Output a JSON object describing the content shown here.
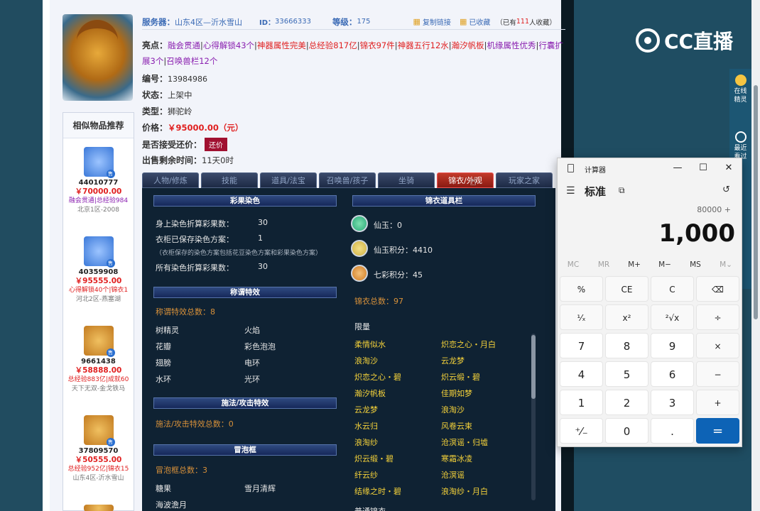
{
  "listing": {
    "server_label": "服务器：",
    "server": "山东4区—沂水雪山",
    "id_label": "ID：",
    "id": "33666333",
    "level_label": "等级：",
    "level": "175",
    "copy_link": "复制链接",
    "favorited": "已收藏",
    "fav_count_pre": "（已有",
    "fav_count": "111",
    "fav_count_post": "人收藏）",
    "highlights_label": "亮点：",
    "highlights": [
      "融会贯通",
      "心得解锁43个",
      "神器属性完美",
      "总经验817亿",
      "锦衣97件",
      "神器五行12水",
      "瀚汐帆板",
      "机缘属性优秀",
      "行囊扩展3个",
      "召唤兽栏12个"
    ],
    "number_label": "编号：",
    "number": "13984986",
    "status_label": "状态：",
    "status": "上架中",
    "type_label": "类型：",
    "type": "狮驼岭",
    "price_label": "价格：",
    "price": "￥95000.00（元）",
    "bargain_label": "是否接受还价：",
    "bargain_button": "还价",
    "remaining_label": "出售剩余时间：",
    "remaining": "11天0时"
  },
  "similar": {
    "title": "相似物品推荐",
    "items": [
      {
        "id": "44010777",
        "price": "￥70000.00",
        "tags": "融会贯通|总经验984",
        "server": "北京1区-2008",
        "color": "#3a78d8"
      },
      {
        "id": "40359908",
        "price": "￥95555.00",
        "tags": "心得解锁40个|锦衣1",
        "server": "河北2区-燕塞湖",
        "color": "#3a78d8"
      },
      {
        "id": "9661438",
        "price": "￥58888.00",
        "tags": "总经验883亿|成就60",
        "server": "天下无双-金戈铁马",
        "color": "#c27a20"
      },
      {
        "id": "37809570",
        "price": "￥50555.00",
        "tags": "总经验952亿|锦衣15",
        "server": "山东4区-沂水雪山",
        "color": "#c27a20"
      }
    ]
  },
  "tabs": [
    "人物/修炼",
    "技能",
    "道具/法宝",
    "召唤兽/孩子",
    "坐骑",
    "锦衣/外观",
    "玩家之家"
  ],
  "game": {
    "dye_head": "彩果染色",
    "dye_rows": [
      {
        "label": "身上染色折算彩果数：",
        "value": "30"
      },
      {
        "label": "衣柜已保存染色方案：",
        "value": "1"
      },
      {
        "label": "所有染色折算彩果数：",
        "value": "30"
      }
    ],
    "dye_note": "（衣柜保存的染色方案包括花豆染色方案和彩果染色方案）",
    "title_head": "称谓特效",
    "title_total": "称谓特效总数：8",
    "title_effects": [
      "树精灵",
      "火焰",
      "花瓣",
      "彩色泡泡",
      "翅膀",
      "电环",
      "水环",
      "光环"
    ],
    "spell_head": "施法/攻击特效",
    "spell_total": "施法/攻击特效总数：0",
    "bubble_head": "冒泡框",
    "bubble_total": "冒泡框总数：3",
    "bubble_items": [
      "糖果",
      "雪月清辉",
      "海波澹月"
    ],
    "wardrobe_head": "锦衣道具栏",
    "currencies": [
      {
        "label": "仙玉：0",
        "color": "#28a878"
      },
      {
        "label": "仙玉积分：4410",
        "color": "#d0b040"
      },
      {
        "label": "七彩积分：45",
        "color": "#d07a20"
      }
    ],
    "wardrobe_total": "锦衣总数：97",
    "limited": "限量",
    "outfits_left": [
      "柔情似水",
      "浪淘沙",
      "炽恋之心・碧",
      "瀚汐帆板",
      "云龙梦",
      "水云归",
      "浪淘纱",
      "炽云缎・碧",
      "纤云纱",
      "结缘之时・碧"
    ],
    "outfits_right": [
      "炽恋之心・月白",
      "云龙梦",
      "炽云缎・碧",
      "佳期如梦",
      "浪淘沙",
      "风卷云束",
      "沧溟谣・归墟",
      "寒霜冰凌",
      "沧溟谣",
      "浪淘纱・月白"
    ],
    "normal_head": "普通锦衣"
  },
  "calculator": {
    "title": "计算器",
    "mode": "标准",
    "expression": "80000 +",
    "display": "1,000",
    "memory": [
      "MC",
      "MR",
      "M+",
      "M−",
      "MS",
      "M⌄"
    ],
    "keys": [
      [
        "%",
        "CE",
        "C",
        "⌫"
      ],
      [
        "¹⁄ₓ",
        "x²",
        "²√x",
        "÷"
      ],
      [
        "7",
        "8",
        "9",
        "×"
      ],
      [
        "4",
        "5",
        "6",
        "−"
      ],
      [
        "1",
        "2",
        "3",
        "+"
      ],
      [
        "⁺⁄₋",
        "0",
        ".",
        "="
      ]
    ]
  },
  "stream": {
    "logo": "CC直播",
    "side_online": "在线精灵",
    "side_recent": "最近看过"
  }
}
